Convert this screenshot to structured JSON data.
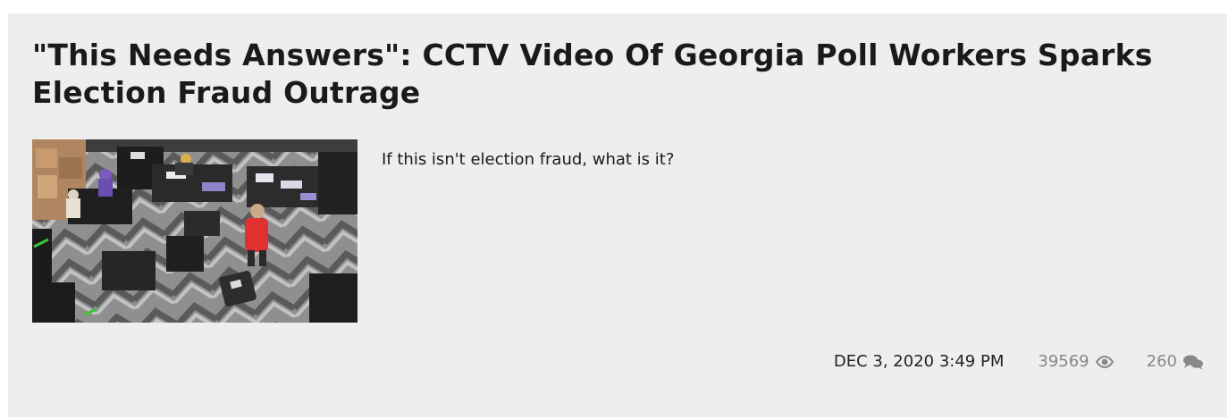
{
  "article": {
    "title": "\"This Needs Answers\": CCTV Video Of Georgia Poll Workers Sparks Election Fraud Outrage",
    "teaser": "If this isn't election fraud, what is it?",
    "date": "DEC 3, 2020 3:49 PM",
    "views": "39569",
    "comments": "260"
  },
  "icons": {
    "views_icon": "eye-icon",
    "comments_icon": "speech-bubbles-icon"
  },
  "colors": {
    "card_background": "#eeeeee",
    "title_text": "#1a1a1a",
    "meta_muted": "#888888"
  }
}
